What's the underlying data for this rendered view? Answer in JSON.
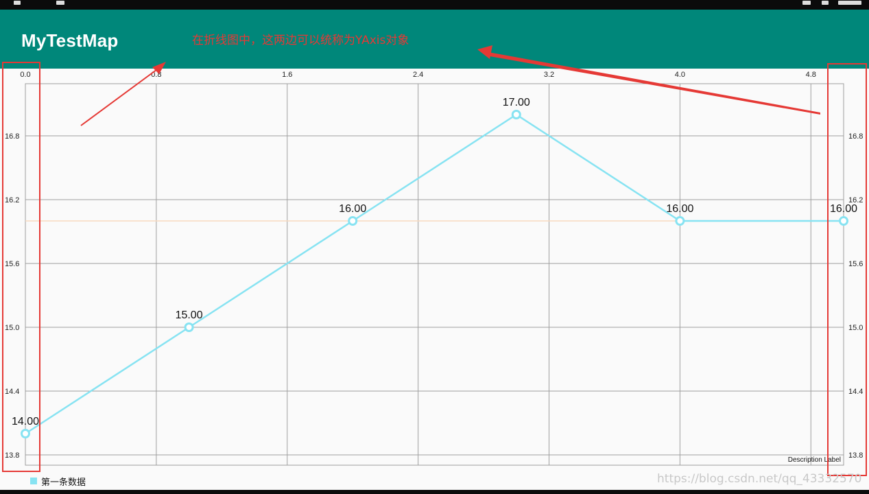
{
  "app": {
    "title": "MyTestMap"
  },
  "annotation": {
    "text": "在折线图中，这两边可以统称为YAxis对象",
    "color": "#e53935"
  },
  "watermark": {
    "text": "https://blog.csdn.net/qq_43332570"
  },
  "colors": {
    "app_bar": "#00877a",
    "line": "#87e3f2",
    "grid": "#9e9e9e",
    "limit_line": "#f8d9c0"
  },
  "chart_data": {
    "type": "line",
    "x_ticks": [
      "0.0",
      "0.8",
      "1.6",
      "2.4",
      "3.2",
      "4.0",
      "4.8"
    ],
    "y_left_ticks": [
      "16.8",
      "16.2",
      "15.6",
      "15.0",
      "14.4",
      "13.8"
    ],
    "y_right_ticks": [
      "16.8",
      "16.2",
      "15.6",
      "15.0",
      "14.4",
      "13.8"
    ],
    "xlim": [
      0,
      5
    ],
    "ylim": [
      13.8,
      17.3
    ],
    "grid": true,
    "series": [
      {
        "name": "第一条数据",
        "x": [
          0,
          1,
          2,
          3,
          4,
          5
        ],
        "values": [
          14,
          15,
          16,
          17,
          16,
          16
        ],
        "labels": [
          "14.00",
          "15.00",
          "16.00",
          "17.00",
          "16.00",
          "16.00"
        ]
      }
    ],
    "limit_line": 16,
    "description": "Description Label",
    "legend_position": "bottom-left"
  }
}
